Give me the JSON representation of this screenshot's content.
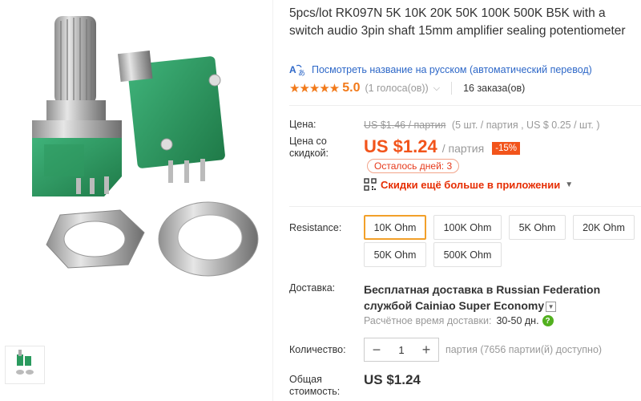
{
  "product": {
    "title": "5pcs/lot RK097N 5K 10K 20K 50K 100K 500K B5K with a switch audio 3pin shaft 15mm amplifier sealing potentiometer",
    "translate_link": "Посмотреть название на русском (автоматический перевод)",
    "rating": {
      "stars": "★★★★★",
      "score": "5.0",
      "votes": "(1 голоса(ов))",
      "orders": "16 заказа(ов)"
    }
  },
  "pricing": {
    "price_label": "Цена:",
    "original_price": "US $1.46 / партия",
    "original_unit": "(5 шт. / партия , US $ 0.25 / шт. )",
    "discount_label_1": "Цена со",
    "discount_label_2": "скидкой:",
    "price": "US $1.24",
    "price_unit": "/ партия",
    "discount": "-15%",
    "days_left": "Осталось дней: 3",
    "app_promo": "Скидки ещё больше в приложении"
  },
  "sku": {
    "label": "Resistance:",
    "selected": "10K Ohm",
    "options": [
      "10K Ohm",
      "100K Ohm",
      "5K Ohm",
      "20K Ohm",
      "50K Ohm",
      "500K Ohm"
    ]
  },
  "shipping": {
    "label": "Доставка:",
    "title_1": "Бесплатная доставка в Russian Federation",
    "title_2": "службой Cainiao Super Economy",
    "time_label": "Расчётное время доставки:",
    "time_value": "30-50 дн."
  },
  "quantity": {
    "label": "Количество:",
    "minus": "−",
    "value": "1",
    "plus": "+",
    "available": "партия (7656 партии(й) доступно)"
  },
  "total": {
    "label_1": "Общая",
    "label_2": "стоимость:",
    "value": "US $1.24"
  },
  "colors": {
    "accent_orange": "#f2541b",
    "link_blue": "#2e68c8",
    "star_orange": "#f27a1a",
    "selected_border": "#f2a02a",
    "pot_green": "#2a9a5e"
  },
  "icons": {
    "translate": "translate-icon",
    "qr": "qr-code-icon",
    "help": "help-icon",
    "dropdown": "chevron-down-icon"
  }
}
